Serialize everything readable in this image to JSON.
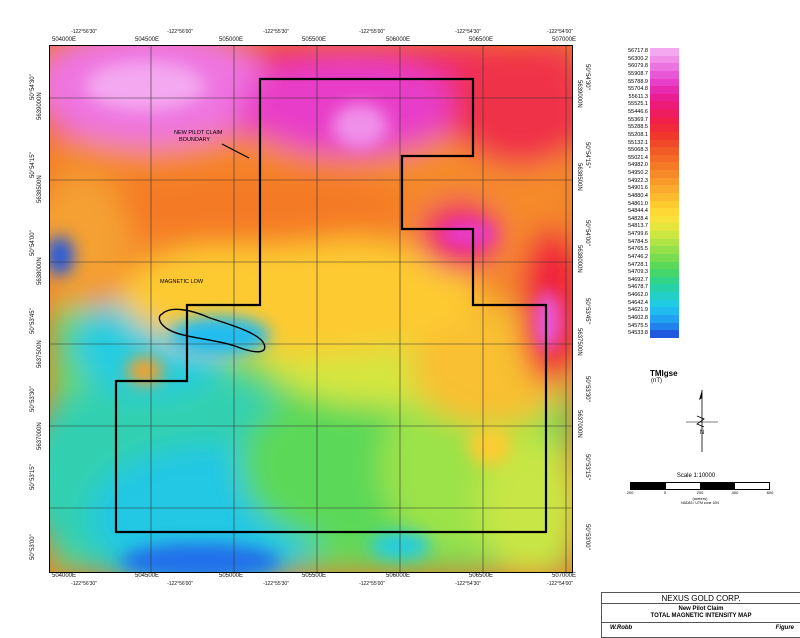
{
  "map": {
    "top_eastings": [
      "504000E",
      "504500E",
      "505000E",
      "505500E",
      "506000E",
      "506500E",
      "507000E"
    ],
    "top_longitudes": [
      "-122°56'30\"",
      "-122°56'00\"",
      "-122°55'30\"",
      "-122°55'00\"",
      "-122°54'30\"",
      "-122°54'00\""
    ],
    "bottom_eastings": [
      "504000E",
      "504500E",
      "505000E",
      "505500E",
      "506000E",
      "506500E",
      "507000E"
    ],
    "bottom_longitudes": [
      "-122°56'30\"",
      "-122°56'00\"",
      "-122°55'30\"",
      "-122°55'00\"",
      "-122°54'30\"",
      "-122°54'00\""
    ],
    "left_northings": [
      "5639000N",
      "5638500N",
      "5638000N",
      "5637500N",
      "5637000N"
    ],
    "left_latitudes": [
      "50°54'30\"",
      "50°54'15\"",
      "50°54'00\"",
      "50°53'45\"",
      "50°53'30\"",
      "50°53'15\"",
      "50°53'00\""
    ],
    "right_northings": [
      "5639000N",
      "5638500N",
      "5638000N",
      "5637500N",
      "5637000N"
    ],
    "right_latitudes": [
      "50°54'30\"",
      "50°54'15\"",
      "50°54'00\"",
      "50°53'45\"",
      "50°53'30\"",
      "50°53'15\"",
      "50°53'00\""
    ],
    "annotation_claim_line1": "NEW PILOT CLAIM",
    "annotation_claim_line2": "BOUNDARY",
    "annotation_magnetic_low": "MAGNETIC LOW"
  },
  "legend": {
    "title": "TMIgse",
    "unit": "(nT)",
    "items": [
      {
        "label": "56717.8",
        "color": "#f4a8f0"
      },
      {
        "label": "56300.2",
        "color": "#f08ee8"
      },
      {
        "label": "56079.8",
        "color": "#ec74e0"
      },
      {
        "label": "55908.7",
        "color": "#e858d6"
      },
      {
        "label": "55788.9",
        "color": "#e83ec8"
      },
      {
        "label": "55704.8",
        "color": "#e82aae"
      },
      {
        "label": "55611.3",
        "color": "#ea1e92"
      },
      {
        "label": "55525.1",
        "color": "#ec1a78"
      },
      {
        "label": "55446.6",
        "color": "#ee1c60"
      },
      {
        "label": "55369.7",
        "color": "#f0204a"
      },
      {
        "label": "55288.5",
        "color": "#f02a38"
      },
      {
        "label": "55208.1",
        "color": "#f0382a"
      },
      {
        "label": "55132.1",
        "color": "#f04828"
      },
      {
        "label": "55068.3",
        "color": "#f25a26"
      },
      {
        "label": "55021.4",
        "color": "#f46a26"
      },
      {
        "label": "54982.0",
        "color": "#f47a26"
      },
      {
        "label": "54950.2",
        "color": "#f68a28"
      },
      {
        "label": "54922.3",
        "color": "#f89a2a"
      },
      {
        "label": "54901.6",
        "color": "#faaa2c"
      },
      {
        "label": "54880.4",
        "color": "#fcba2e"
      },
      {
        "label": "54861.0",
        "color": "#fdca30"
      },
      {
        "label": "54844.4",
        "color": "#fed834"
      },
      {
        "label": "54828.4",
        "color": "#f6e23a"
      },
      {
        "label": "54813.7",
        "color": "#e4e63e"
      },
      {
        "label": "54799.6",
        "color": "#cce642"
      },
      {
        "label": "54784.5",
        "color": "#b0e446"
      },
      {
        "label": "54765.5",
        "color": "#94e04a"
      },
      {
        "label": "54746.2",
        "color": "#78dc50"
      },
      {
        "label": "54728.1",
        "color": "#5cd858"
      },
      {
        "label": "54709.3",
        "color": "#44d66a"
      },
      {
        "label": "54692.7",
        "color": "#32d488"
      },
      {
        "label": "54678.7",
        "color": "#28d2a8"
      },
      {
        "label": "54662.0",
        "color": "#22d0c8"
      },
      {
        "label": "54642.4",
        "color": "#20cce4"
      },
      {
        "label": "54621.9",
        "color": "#20bcf0"
      },
      {
        "label": "54602.8",
        "color": "#20a2f0"
      },
      {
        "label": "54575.5",
        "color": "#2082ec"
      },
      {
        "label": "54533.8",
        "color": "#2058e0"
      }
    ]
  },
  "north_arrow": {
    "label": "N"
  },
  "scale": {
    "title": "Scale 1:10000",
    "ticks": [
      "200",
      "0",
      "200",
      "400",
      "600"
    ],
    "unit": "(meters)",
    "datum": "NAD83 / UTM zone 10N"
  },
  "title_block": {
    "company": "NEXUS GOLD CORP.",
    "project": "New Pilot Claim",
    "map_title": "TOTAL MAGNETIC INTENSITY MAP",
    "author": "W.Robb",
    "figure": "Figure"
  }
}
